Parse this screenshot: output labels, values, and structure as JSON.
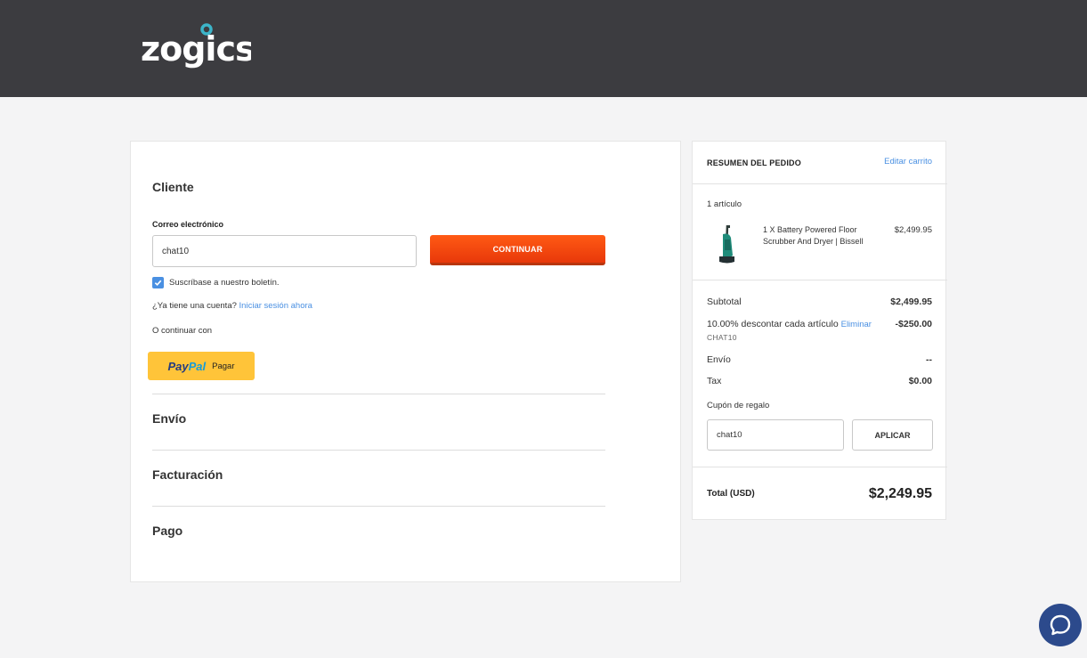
{
  "header": {
    "logo_text": "zogics"
  },
  "checkout": {
    "customer": {
      "title": "Cliente",
      "email_label": "Correo electrónico",
      "email_value": "chat10",
      "continue_label": "CONTINUAR",
      "newsletter_label": "Suscríbase a nuestro boletín.",
      "newsletter_checked": true,
      "account_prompt": "¿Ya tiene una cuenta?",
      "signin_link": "Iniciar sesión ahora",
      "or_continue": "O continuar con",
      "paypal": {
        "brand_pay": "Pay",
        "brand_pal": "Pal",
        "label": "Pagar"
      }
    },
    "shipping_title": "Envío",
    "billing_title": "Facturación",
    "payment_title": "Pago"
  },
  "summary": {
    "title": "RESUMEN DEL PEDIDO",
    "edit_cart": "Editar carrito",
    "item_count": "1 artículo",
    "item": {
      "name": "1 X Battery Powered Floor Scrubber And Dryer | Bissell",
      "price": "$2,499.95",
      "icon": "floor-scrubber-image"
    },
    "subtotal_label": "Subtotal",
    "subtotal_value": "$2,499.95",
    "discount_label": "10.00% descontar cada artículo",
    "discount_remove": "Eliminar",
    "discount_value": "-$250.00",
    "discount_code": "CHAT10",
    "shipping_label": "Envío",
    "shipping_value": "--",
    "tax_label": "Tax",
    "tax_value": "$0.00",
    "coupon_label": "Cupón de regalo",
    "coupon_value": "chat10",
    "apply_label": "APLICAR",
    "total_label": "Total (USD)",
    "total_value": "$2,249.95"
  },
  "colors": {
    "header_bg": "#3c3c40",
    "accent_orange": "#f04e0f",
    "link_blue": "#4a90e2",
    "paypal_yellow": "#ffc439",
    "chat_blue": "#2c4a8c",
    "logo_dot": "#3cb4c8"
  }
}
